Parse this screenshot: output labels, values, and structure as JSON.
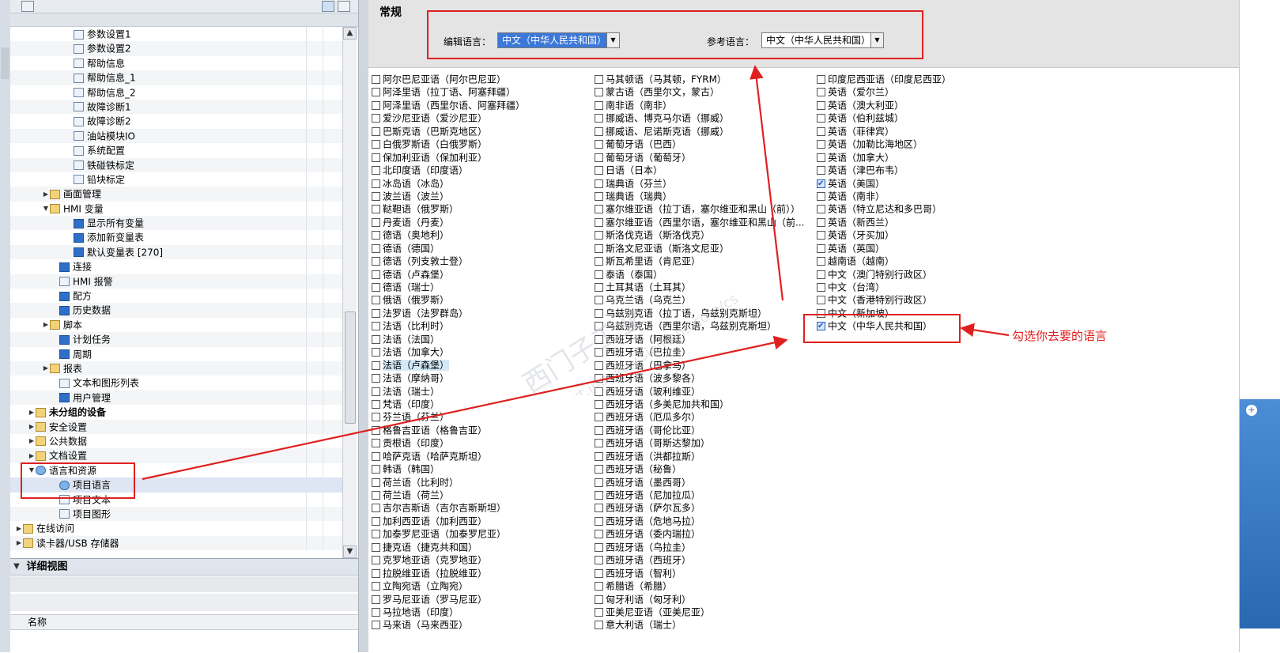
{
  "tree": {
    "items": [
      {
        "label": "参数设置1",
        "indent": 70,
        "icon": "page-icon",
        "kind": "page"
      },
      {
        "label": "参数设置2",
        "indent": 70,
        "icon": "page-icon",
        "kind": "page"
      },
      {
        "label": "帮助信息",
        "indent": 70,
        "icon": "page-icon",
        "kind": "page"
      },
      {
        "label": "帮助信息_1",
        "indent": 70,
        "icon": "page-icon",
        "kind": "page"
      },
      {
        "label": "帮助信息_2",
        "indent": 70,
        "icon": "page-icon",
        "kind": "page"
      },
      {
        "label": "故障诊断1",
        "indent": 70,
        "icon": "page-icon",
        "kind": "page"
      },
      {
        "label": "故障诊断2",
        "indent": 70,
        "icon": "page-icon",
        "kind": "page"
      },
      {
        "label": "油站模块IO",
        "indent": 70,
        "icon": "page-icon",
        "kind": "page"
      },
      {
        "label": "系统配置",
        "indent": 70,
        "icon": "page-icon",
        "kind": "page"
      },
      {
        "label": "铁碰铁标定",
        "indent": 70,
        "icon": "page-icon",
        "kind": "page"
      },
      {
        "label": "铅块标定",
        "indent": 70,
        "icon": "page-icon",
        "kind": "page"
      },
      {
        "label": "画面管理",
        "indent": 40,
        "icon": "folder-icon",
        "kind": "folder",
        "toggle": "▶"
      },
      {
        "label": "HMI 变量",
        "indent": 40,
        "icon": "folder-icon",
        "kind": "folder",
        "toggle": "▼"
      },
      {
        "label": "显示所有变量",
        "indent": 70,
        "icon": "tag-table-icon",
        "kind": "blue"
      },
      {
        "label": "添加新变量表",
        "indent": 70,
        "icon": "add-table-icon",
        "kind": "blue"
      },
      {
        "label": "默认变量表 [270]",
        "indent": 70,
        "icon": "tag-table-icon",
        "kind": "blue"
      },
      {
        "label": "连接",
        "indent": 52,
        "icon": "connection-icon",
        "kind": "blue"
      },
      {
        "label": "HMI 报警",
        "indent": 52,
        "icon": "alarm-icon",
        "kind": "page"
      },
      {
        "label": "配方",
        "indent": 52,
        "icon": "recipe-icon",
        "kind": "blue"
      },
      {
        "label": "历史数据",
        "indent": 52,
        "icon": "history-icon",
        "kind": "blue"
      },
      {
        "label": "脚本",
        "indent": 40,
        "icon": "script-icon",
        "kind": "folder",
        "toggle": "▶"
      },
      {
        "label": "计划任务",
        "indent": 52,
        "icon": "scheduler-icon",
        "kind": "blue"
      },
      {
        "label": "周期",
        "indent": 52,
        "icon": "cycle-icon",
        "kind": "blue"
      },
      {
        "label": "报表",
        "indent": 40,
        "icon": "report-icon",
        "kind": "folder",
        "toggle": "▶"
      },
      {
        "label": "文本和图形列表",
        "indent": 52,
        "icon": "text-list-icon",
        "kind": "page"
      },
      {
        "label": "用户管理",
        "indent": 52,
        "icon": "user-admin-icon",
        "kind": "blue"
      },
      {
        "label": "未分组的设备",
        "indent": 22,
        "icon": "devices-icon",
        "kind": "folder",
        "toggle": "▶",
        "bold": true
      },
      {
        "label": "安全设置",
        "indent": 22,
        "icon": "security-icon",
        "kind": "folder",
        "toggle": "▶"
      },
      {
        "label": "公共数据",
        "indent": 22,
        "icon": "common-data-icon",
        "kind": "folder",
        "toggle": "▶"
      },
      {
        "label": "文档设置",
        "indent": 22,
        "icon": "doc-settings-icon",
        "kind": "folder",
        "toggle": "▶"
      },
      {
        "label": "语言和资源",
        "indent": 22,
        "icon": "languages-icon",
        "kind": "globe",
        "toggle": "▼"
      },
      {
        "label": "项目语言",
        "indent": 52,
        "icon": "project-language-icon",
        "kind": "globe",
        "selected": true
      },
      {
        "label": "项目文本",
        "indent": 52,
        "icon": "project-text-icon",
        "kind": "page"
      },
      {
        "label": "项目图形",
        "indent": 52,
        "icon": "project-graphics-icon",
        "kind": "page"
      },
      {
        "label": "在线访问",
        "indent": 6,
        "icon": "online-access-icon",
        "kind": "folder",
        "toggle": "▶"
      },
      {
        "label": "读卡器/USB 存储器",
        "indent": 6,
        "icon": "card-reader-icon",
        "kind": "folder",
        "toggle": "▶"
      }
    ]
  },
  "details": {
    "title": "详细视图",
    "column_name": "名称"
  },
  "general": {
    "title": "常规",
    "editing_language_label": "编辑语言：",
    "editing_language_value": "中文（中华人民共和国）",
    "reference_language_label": "参考语言：",
    "reference_language_value": "中文（中华人民共和国）"
  },
  "languages": {
    "col1": [
      {
        "label": "阿尔巴尼亚语（阿尔巴尼亚）"
      },
      {
        "label": "阿泽里语（拉丁语、阿塞拜疆）"
      },
      {
        "label": "阿泽里语（西里尔语、阿塞拜疆）"
      },
      {
        "label": "爱沙尼亚语（爱沙尼亚）"
      },
      {
        "label": "巴斯克语（巴斯克地区）"
      },
      {
        "label": "白俄罗斯语（白俄罗斯）"
      },
      {
        "label": "保加利亚语（保加利亚）"
      },
      {
        "label": "北印度语（印度语）"
      },
      {
        "label": "冰岛语（冰岛）"
      },
      {
        "label": "波兰语（波兰）"
      },
      {
        "label": "鞑靼语（俄罗斯）"
      },
      {
        "label": "丹麦语（丹麦）"
      },
      {
        "label": "德语（奥地利）"
      },
      {
        "label": "德语（德国）"
      },
      {
        "label": "德语（列支敦士登）"
      },
      {
        "label": "德语（卢森堡）"
      },
      {
        "label": "德语（瑞士）"
      },
      {
        "label": "俄语（俄罗斯）"
      },
      {
        "label": "法罗语（法罗群岛）"
      },
      {
        "label": "法语（比利时）"
      },
      {
        "label": "法语（法国）"
      },
      {
        "label": "法语（加拿大）"
      },
      {
        "label": "法语（卢森堡）",
        "highlight": true
      },
      {
        "label": "法语（摩纳哥）"
      },
      {
        "label": "法语（瑞士）"
      },
      {
        "label": "梵语（印度）"
      },
      {
        "label": "芬兰语（芬兰）"
      },
      {
        "label": "格鲁吉亚语（格鲁吉亚）"
      },
      {
        "label": "贡根语（印度）"
      },
      {
        "label": "哈萨克语（哈萨克斯坦）"
      },
      {
        "label": "韩语（韩国）"
      },
      {
        "label": "荷兰语（比利时）"
      },
      {
        "label": "荷兰语（荷兰）"
      },
      {
        "label": "吉尔吉斯语（吉尔吉斯斯坦）"
      },
      {
        "label": "加利西亚语（加利西亚）"
      },
      {
        "label": "加泰罗尼亚语（加泰罗尼亚）"
      },
      {
        "label": "捷克语（捷克共和国）"
      },
      {
        "label": "克罗地亚语（克罗地亚）"
      },
      {
        "label": "拉脱维亚语（拉脱维亚）"
      },
      {
        "label": "立陶宛语（立陶宛）"
      },
      {
        "label": "罗马尼亚语（罗马尼亚）"
      },
      {
        "label": "马拉地语（印度）"
      },
      {
        "label": "马来语（马来西亚）"
      }
    ],
    "col2": [
      {
        "label": "马其顿语（马其顿，FYRM）"
      },
      {
        "label": "蒙古语（西里尔文，蒙古）"
      },
      {
        "label": "南非语（南非）"
      },
      {
        "label": "挪威语、博克马尔语（挪威）"
      },
      {
        "label": "挪威语、尼诺斯克语（挪威）"
      },
      {
        "label": "葡萄牙语（巴西）"
      },
      {
        "label": "葡萄牙语（葡萄牙）"
      },
      {
        "label": "日语（日本）"
      },
      {
        "label": "瑞典语（芬兰）"
      },
      {
        "label": "瑞典语（瑞典）"
      },
      {
        "label": "塞尔维亚语（拉丁语，塞尔维亚和黑山（前））"
      },
      {
        "label": "塞尔维亚语（西里尔语，塞尔维亚和黑山（前..."
      },
      {
        "label": "斯洛伐克语（斯洛伐克）"
      },
      {
        "label": "斯洛文尼亚语（斯洛文尼亚）"
      },
      {
        "label": "斯瓦希里语（肯尼亚）"
      },
      {
        "label": "泰语（泰国）"
      },
      {
        "label": "土耳其语（土耳其）"
      },
      {
        "label": "乌克兰语（乌克兰）"
      },
      {
        "label": "乌兹别克语（拉丁语，乌兹别克斯坦）"
      },
      {
        "label": "乌兹别克语（西里尔语，乌兹别克斯坦）"
      },
      {
        "label": "西班牙语（阿根廷）"
      },
      {
        "label": "西班牙语（巴拉圭）"
      },
      {
        "label": "西班牙语（巴拿马）"
      },
      {
        "label": "西班牙语（波多黎各）"
      },
      {
        "label": "西班牙语（玻利维亚）"
      },
      {
        "label": "西班牙语（多美尼加共和国）"
      },
      {
        "label": "西班牙语（厄瓜多尔）"
      },
      {
        "label": "西班牙语（哥伦比亚）"
      },
      {
        "label": "西班牙语（哥斯达黎加）"
      },
      {
        "label": "西班牙语（洪都拉斯）"
      },
      {
        "label": "西班牙语（秘鲁）"
      },
      {
        "label": "西班牙语（墨西哥）"
      },
      {
        "label": "西班牙语（尼加拉瓜）"
      },
      {
        "label": "西班牙语（萨尔瓦多）"
      },
      {
        "label": "西班牙语（危地马拉）"
      },
      {
        "label": "西班牙语（委内瑞拉）"
      },
      {
        "label": "西班牙语（乌拉圭）"
      },
      {
        "label": "西班牙语（西班牙）"
      },
      {
        "label": "西班牙语（智利）"
      },
      {
        "label": "希腊语（希腊）"
      },
      {
        "label": "匈牙利语（匈牙利）"
      },
      {
        "label": "亚美尼亚语（亚美尼亚）"
      },
      {
        "label": "意大利语（瑞士）"
      }
    ],
    "col3": [
      {
        "label": "印度尼西亚语（印度尼西亚）"
      },
      {
        "label": "英语（爱尔兰）"
      },
      {
        "label": "英语（澳大利亚）"
      },
      {
        "label": "英语（伯利兹城）"
      },
      {
        "label": "英语（菲律宾）"
      },
      {
        "label": "英语（加勒比海地区）"
      },
      {
        "label": "英语（加拿大）"
      },
      {
        "label": "英语（津巴布韦）"
      },
      {
        "label": "英语（美国）",
        "checked": true
      },
      {
        "label": "英语（南非）"
      },
      {
        "label": "英语（特立尼达和多巴哥）"
      },
      {
        "label": "英语（新西兰）"
      },
      {
        "label": "英语（牙买加）"
      },
      {
        "label": "英语（英国）"
      },
      {
        "label": "越南语（越南）"
      },
      {
        "label": "中文（澳门特别行政区）"
      },
      {
        "label": "中文（台湾）"
      },
      {
        "label": "中文（香港特别行政区）"
      },
      {
        "label": "中文（新加坡）"
      },
      {
        "label": "中文（中华人民共和国）",
        "checked": true
      }
    ]
  },
  "annotation": {
    "text": "勾选你去要的语言",
    "color": "#e02020"
  },
  "colors": {
    "accent": "#3c78d8",
    "annotation_red": "#e02020",
    "selected_row": "#dde6f2"
  }
}
